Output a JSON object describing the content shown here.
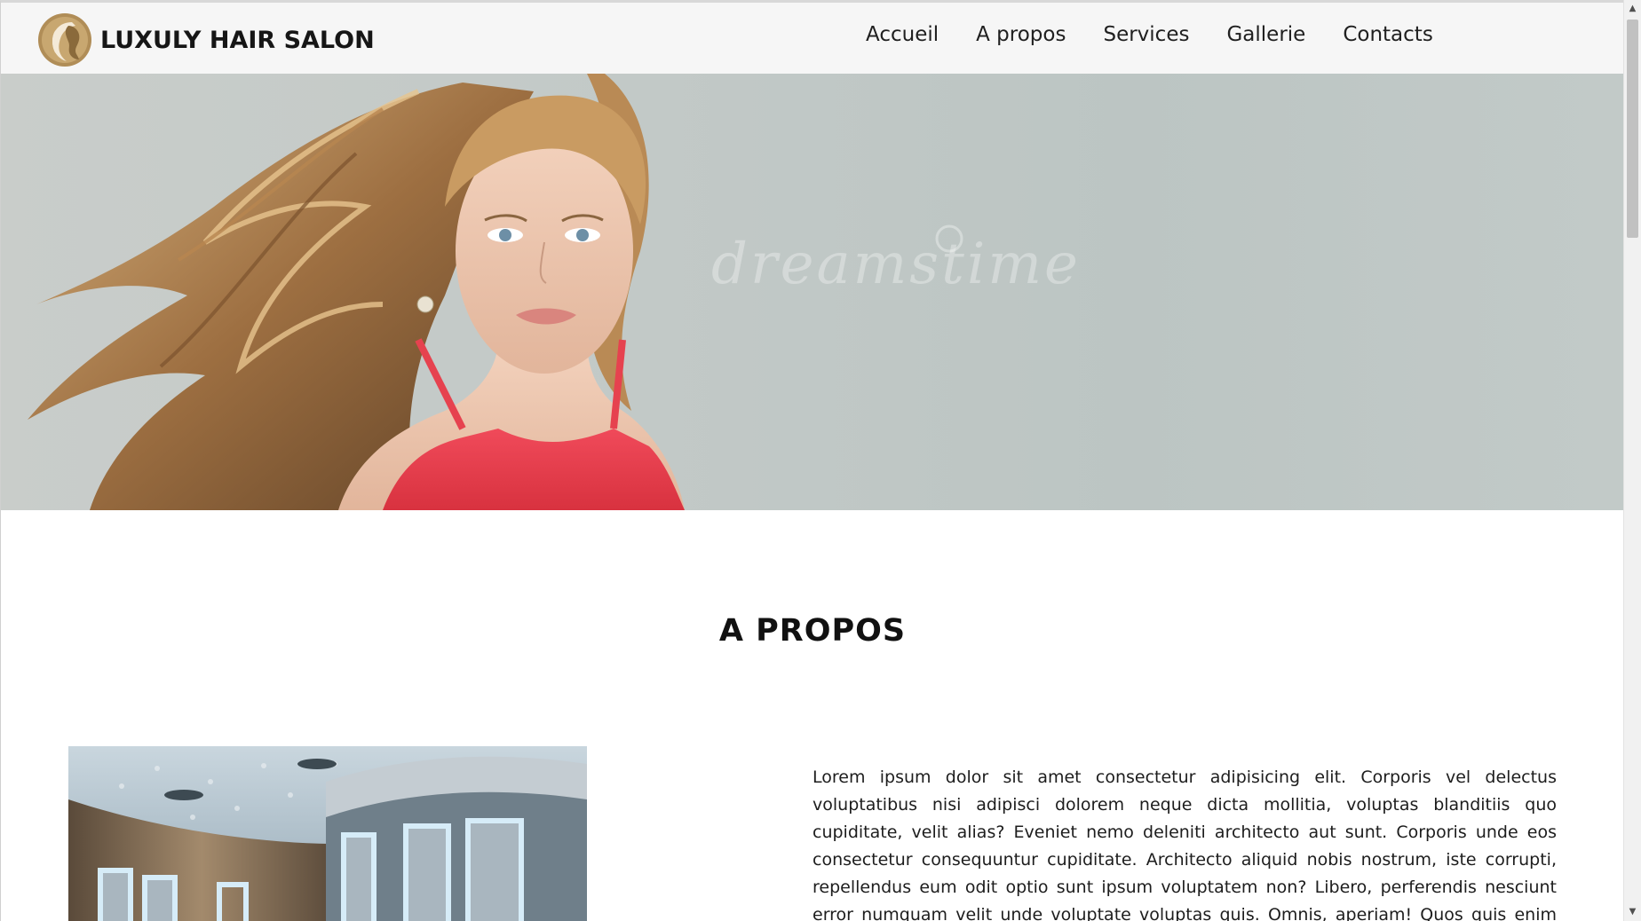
{
  "site": {
    "brand_name": "LUXULY HAIR SALON",
    "logo_icon": "woman-silhouette-logo-icon",
    "brand_color": "#b08d57"
  },
  "nav": {
    "items": [
      {
        "label": "Accueil"
      },
      {
        "label": "A propos"
      },
      {
        "label": "Services"
      },
      {
        "label": "Gallerie"
      },
      {
        "label": "Contacts"
      }
    ]
  },
  "hero": {
    "watermark": "dreamstime",
    "image_subject": "woman-with-flowing-hair-photo"
  },
  "about": {
    "title": "A PROPOS",
    "text": "Lorem ipsum dolor sit amet consectetur adipisicing elit. Corporis vel delectus voluptatibus nisi adipisci dolorem neque dicta mollitia, voluptas blanditiis quo cupiditate, velit alias? Eveniet nemo deleniti architecto aut sunt. Corporis unde eos consectetur consequuntur cupiditate. Architecto aliquid nobis nostrum, iste corrupti, repellendus eum odit optio sunt ipsum voluptatem non? Libero, perferendis nesciunt error numquam velit unde voluptate voluptas quis. Omnis, aperiam! Quos quis enim cupiditate, eaque at natus",
    "image_subject": "salon-interior-photo"
  },
  "scrollbar": {
    "up_icon": "triangle-up-icon",
    "down_icon": "triangle-down-icon",
    "position_fraction": 0.0
  }
}
